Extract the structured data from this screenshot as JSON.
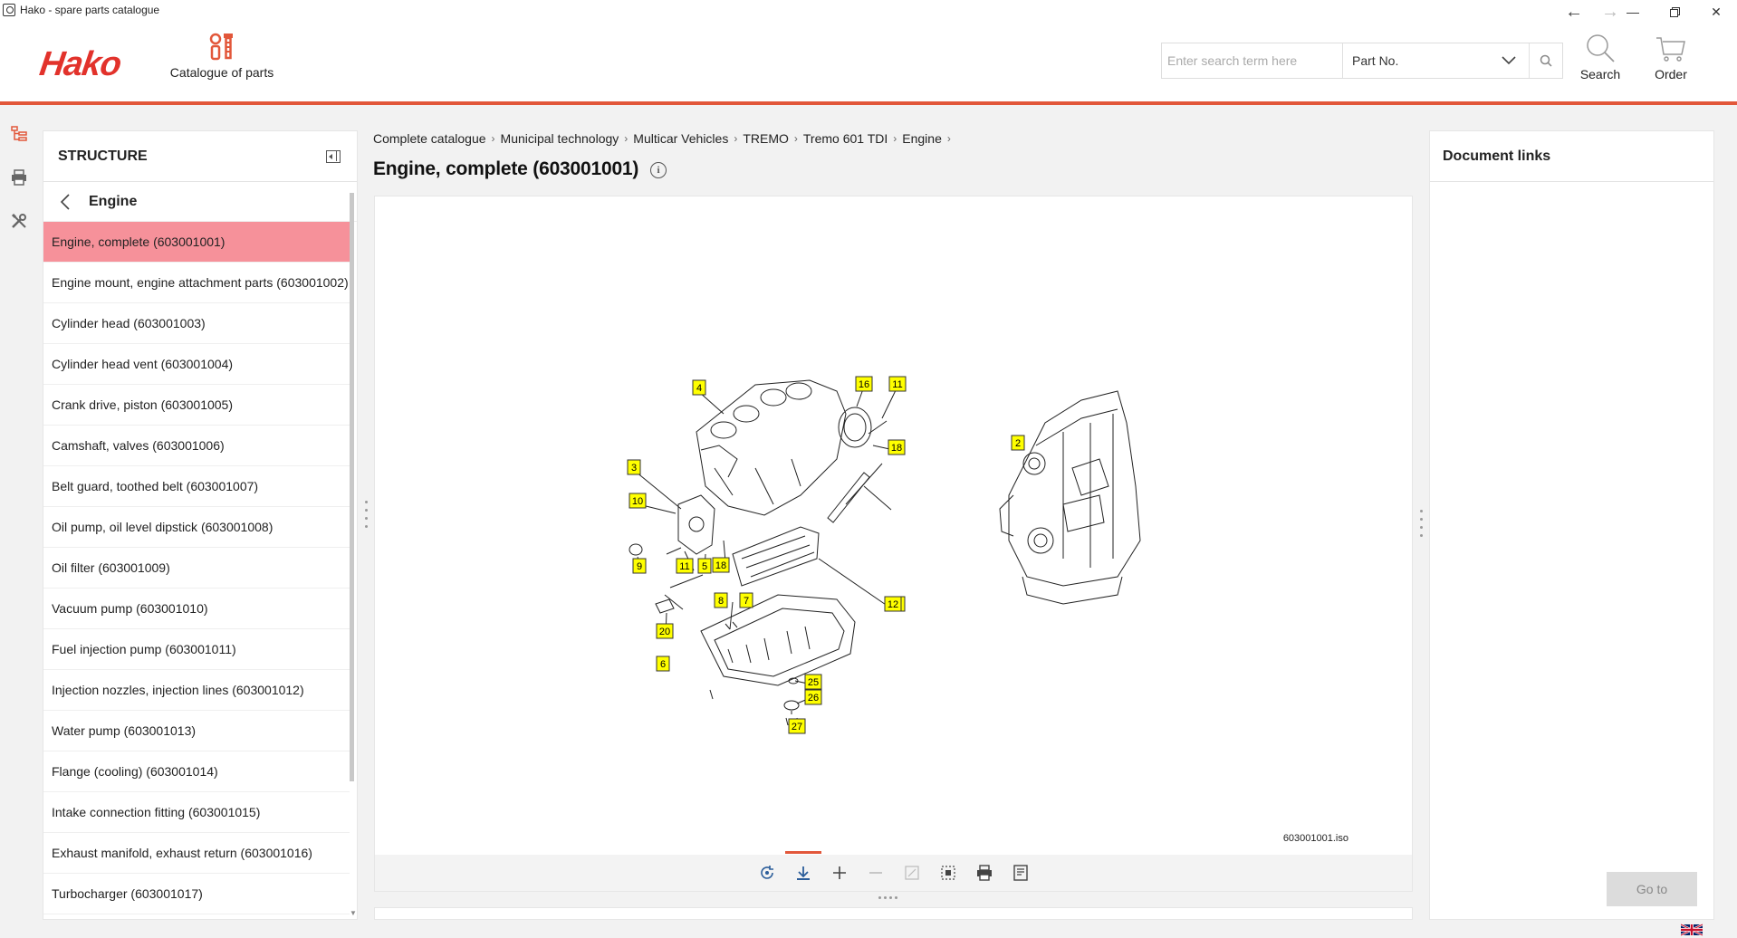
{
  "window": {
    "title": "Hako - spare parts catalogue",
    "controls": [
      "minimize",
      "maximize",
      "close"
    ]
  },
  "header": {
    "logo_text": "Hako",
    "catalogue_label": "Catalogue of parts",
    "search": {
      "placeholder": "Enter search term here",
      "mode_selected": "Part No."
    },
    "search_label": "Search",
    "order_label": "Order"
  },
  "structure": {
    "title": "STRUCTURE",
    "back_label": "Engine",
    "items": [
      {
        "label": "Engine, complete (603001001)",
        "active": true
      },
      {
        "label": "Engine mount, engine attachment parts (603001002)"
      },
      {
        "label": "Cylinder head (603001003)"
      },
      {
        "label": "Cylinder head vent (603001004)"
      },
      {
        "label": "Crank drive, piston (603001005)"
      },
      {
        "label": "Camshaft, valves (603001006)"
      },
      {
        "label": "Belt guard, toothed belt (603001007)"
      },
      {
        "label": "Oil pump, oil level dipstick (603001008)"
      },
      {
        "label": "Oil filter (603001009)"
      },
      {
        "label": "Vacuum pump (603001010)"
      },
      {
        "label": "Fuel injection pump (603001011)"
      },
      {
        "label": "Injection nozzles, injection lines (603001012)"
      },
      {
        "label": "Water pump (603001013)"
      },
      {
        "label": "Flange (cooling) (603001014)"
      },
      {
        "label": "Intake connection fitting (603001015)"
      },
      {
        "label": "Exhaust manifold, exhaust return (603001016)"
      },
      {
        "label": "Turbocharger (603001017)"
      }
    ]
  },
  "breadcrumb": [
    "Complete catalogue",
    "Municipal technology",
    "Multicar Vehicles",
    "TREMO",
    "Tremo 601 TDI",
    "Engine"
  ],
  "page_title": "Engine, complete (603001001)",
  "viewer": {
    "file_name": "603001001.iso",
    "callouts": [
      "4",
      "16",
      "11",
      "3",
      "18",
      "10",
      "17",
      "18",
      "9",
      "11",
      "5",
      "8",
      "7",
      "12",
      "20",
      "6",
      "25",
      "26",
      "27",
      "2"
    ]
  },
  "doc_panel": {
    "title": "Document links",
    "goto_label": "Go to"
  },
  "colors": {
    "accent": "#e2573a",
    "active_item": "#f6919a",
    "callout_fill": "#ffff00"
  }
}
